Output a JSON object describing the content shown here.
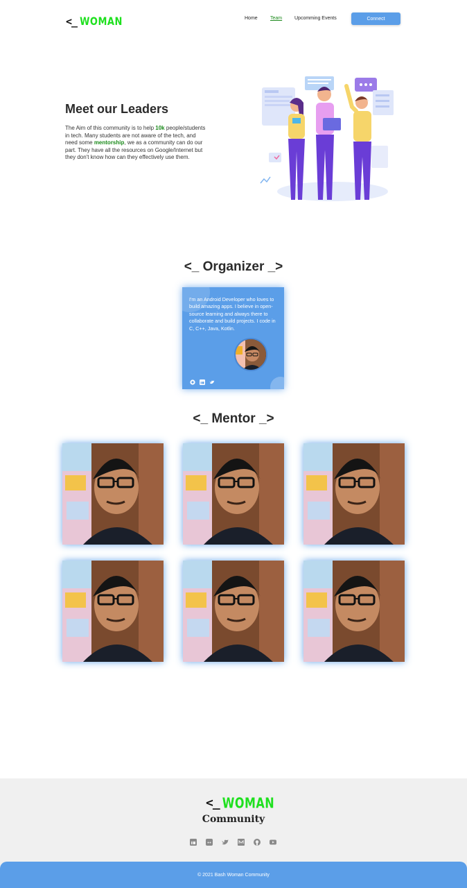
{
  "header": {
    "logo_bracket": "<_",
    "logo_word": "WOMAN",
    "nav": [
      {
        "label": "Home",
        "active": false
      },
      {
        "label": "Team",
        "active": true
      },
      {
        "label": "Upcomming Events",
        "active": false
      }
    ],
    "connect_label": "Connect"
  },
  "hero": {
    "title": "Meet our Leaders",
    "text_1": "The Aim of this community is to help ",
    "highlight_1": "10k",
    "text_2": " people/students in tech. Many students are not aware of the tech, and need some ",
    "highlight_2": "mentorship",
    "text_3": ", we as a community can do our part. They have all the resources on Google/Internet but they don't know how can they effectively use them."
  },
  "organizer": {
    "section_title": "<_ Organizer _>",
    "bio": "I'm an Android Developer who loves to build amazing apps. I believe in open-source learning and always there to collaborate and build projects. I code in C, C++, Java, Kotlin.",
    "socials": [
      "github-icon",
      "linkedin-icon",
      "twitter-icon"
    ]
  },
  "mentors": {
    "section_title": "<_ Mentor _>",
    "count": 6
  },
  "footer": {
    "logo_bracket": "<_",
    "logo_word": "WOMAN",
    "community_label": "Community",
    "icons": [
      "linkedin-icon",
      "discord-icon",
      "twitter-icon",
      "medium-icon",
      "github-icon",
      "youtube-icon"
    ],
    "copyright": "© 2021 Bash Woman Community"
  },
  "colors": {
    "accent_blue": "#5b9ee8",
    "brand_green": "#1fe01f",
    "highlight_green": "#1a8a1a",
    "footer_bg": "#f0f0f0"
  }
}
